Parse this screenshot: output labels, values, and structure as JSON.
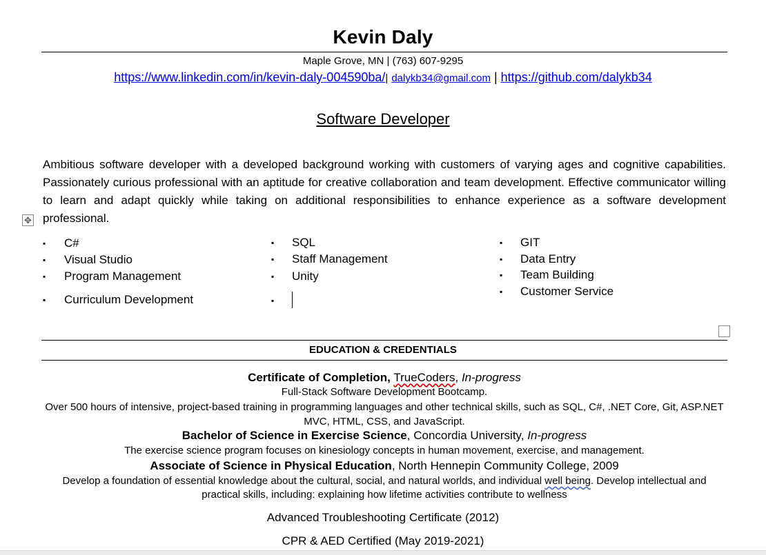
{
  "header": {
    "name": "Kevin Daly",
    "contact_line": "Maple Grove, MN | (763) 607-9295",
    "linkedin": "https://www.linkedin.com/in/kevin-daly-004590ba/",
    "separator_1": "|",
    "email": "dalykb34@gmail.com",
    "separator_2": "|",
    "github": "https://github.com/dalykb34"
  },
  "headline": "Software Developer",
  "summary": "Ambitious software developer with a developed background working with customers of varying ages and cognitive capabilities. Passionately curious professional with an aptitude for creative collaboration and team development. Effective communicator willing to learn and adapt quickly while taking on additional responsibilities to enhance experience as a software development professional.",
  "skills": {
    "bullet": "▪",
    "col1": [
      "C#",
      "Visual Studio",
      "Program Management",
      "Curriculum Development"
    ],
    "col2": [
      "SQL",
      "Staff Management",
      "Unity",
      ""
    ],
    "col3": [
      "GIT",
      "Data Entry",
      "Team Building",
      "Customer Service"
    ]
  },
  "education": {
    "section_title": "EDUCATION & CREDENTIALS",
    "entries": [
      {
        "degree": "Certificate of Completion,",
        "institution": "TrueCoders",
        "comma": ",",
        "status": "In-progress",
        "line1": "Full-Stack Software Development Bootcamp.",
        "line2": "Over 500 hours of intensive, project-based training in programming languages and other technical skills, such as SQL, C#, .NET Core, Git, ASP.NET MVC, HTML, CSS, and JavaScript."
      },
      {
        "degree": "Bachelor of Science in Exercise Science",
        "institution": ", Concordia University, ",
        "status": "In-progress",
        "line1": "The exercise science program focuses on kinesiology concepts in human movement, exercise, and management."
      },
      {
        "degree": "Associate of Science in Physical Education",
        "institution": ", North Hennepin Community College, 2009",
        "line1_a": "Develop a foundation of essential knowledge about the cultural, social, and natural worlds, and individual ",
        "line1_flag": "well being",
        "line1_b": ". Develop intellectual and practical skills, including: explaining how lifetime activities contribute to wellness"
      }
    ]
  },
  "certifications": [
    "Advanced Troubleshooting Certificate (2012)",
    "CPR & AED Certified (May 2019-2021)"
  ],
  "ui": {
    "move_handle_icon": "✥"
  }
}
